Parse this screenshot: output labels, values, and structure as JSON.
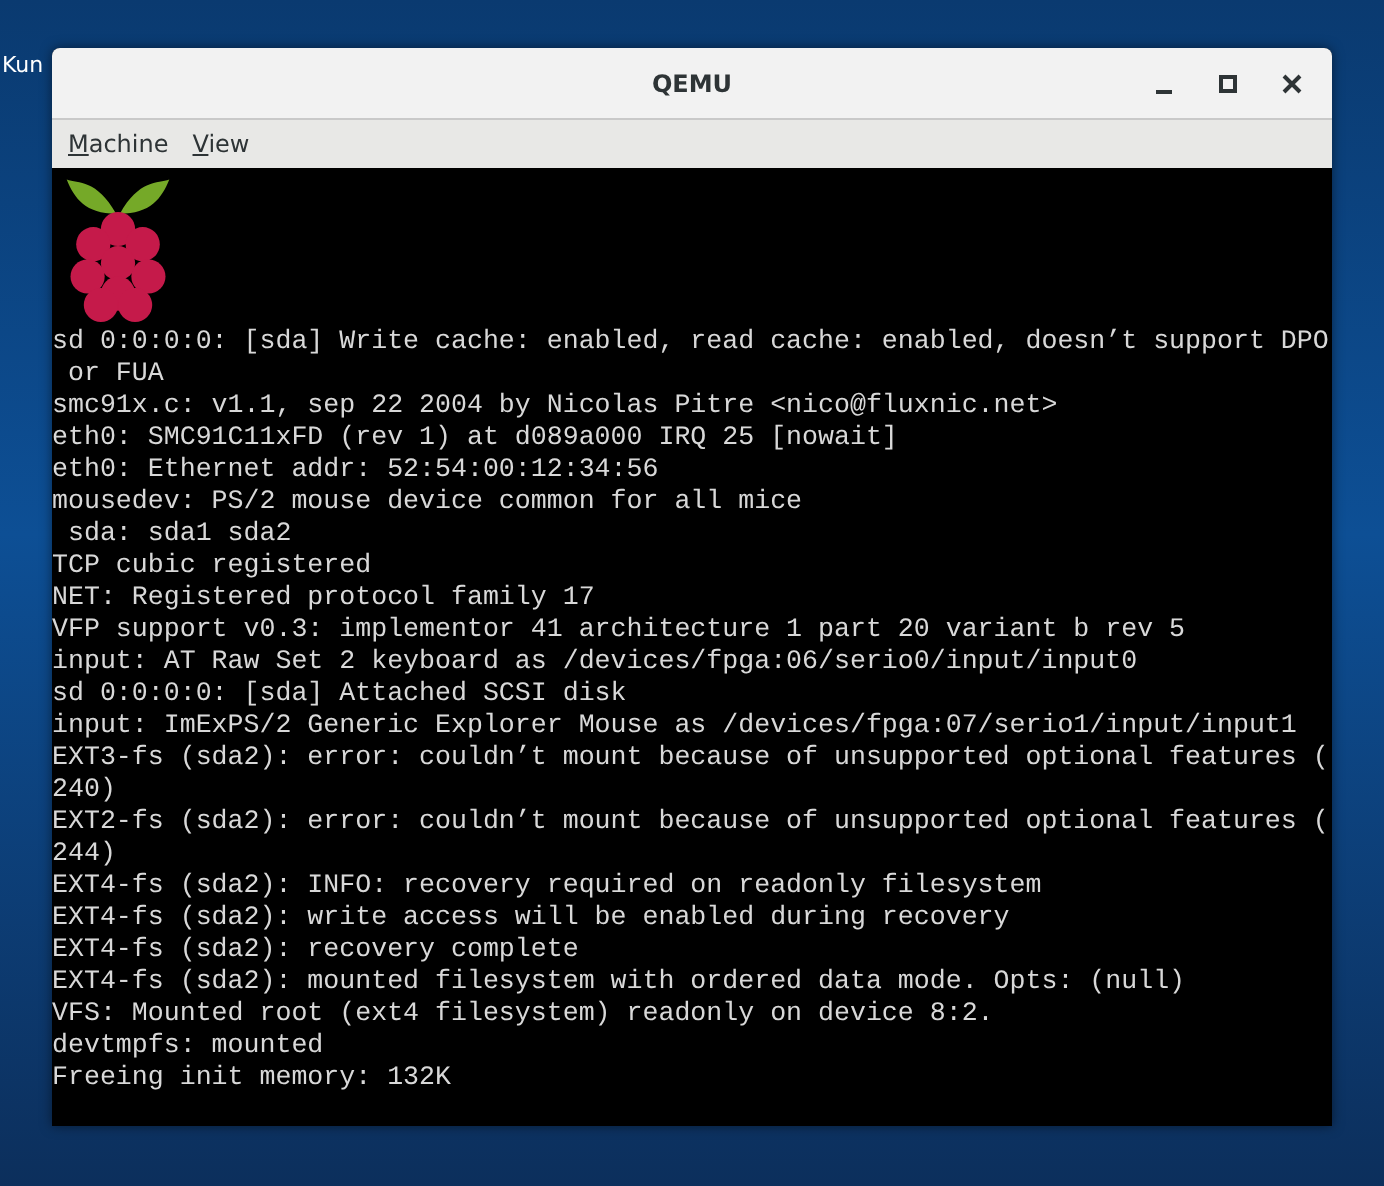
{
  "desktop": {
    "icon_label": "Kun"
  },
  "window": {
    "title": "QEMU"
  },
  "menu": [
    {
      "label": "Machine"
    },
    {
      "label": "View"
    }
  ],
  "console": {
    "lines": [
      "sd 0:0:0:0: [sda] Write cache: enabled, read cache: enabled, doesn’t support DPO",
      " or FUA",
      "smc91x.c: v1.1, sep 22 2004 by Nicolas Pitre <nico@fluxnic.net>",
      "eth0: SMC91C11xFD (rev 1) at d089a000 IRQ 25 [nowait]",
      "eth0: Ethernet addr: 52:54:00:12:34:56",
      "mousedev: PS/2 mouse device common for all mice",
      " sda: sda1 sda2",
      "TCP cubic registered",
      "NET: Registered protocol family 17",
      "VFP support v0.3: implementor 41 architecture 1 part 20 variant b rev 5",
      "input: AT Raw Set 2 keyboard as /devices/fpga:06/serio0/input/input0",
      "sd 0:0:0:0: [sda] Attached SCSI disk",
      "input: ImExPS/2 Generic Explorer Mouse as /devices/fpga:07/serio1/input/input1",
      "EXT3-fs (sda2): error: couldn’t mount because of unsupported optional features (",
      "240)",
      "EXT2-fs (sda2): error: couldn’t mount because of unsupported optional features (",
      "244)",
      "EXT4-fs (sda2): INFO: recovery required on readonly filesystem",
      "EXT4-fs (sda2): write access will be enabled during recovery",
      "EXT4-fs (sda2): recovery complete",
      "EXT4-fs (sda2): mounted filesystem with ordered data mode. Opts: (null)",
      "VFS: Mounted root (ext4 filesystem) readonly on device 8:2.",
      "devtmpfs: mounted",
      "Freeing init memory: 132K"
    ]
  }
}
